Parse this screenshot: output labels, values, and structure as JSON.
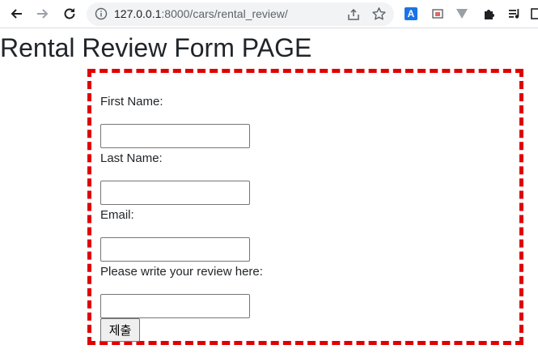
{
  "browser": {
    "url_host": "127.0.0.1",
    "url_path": ":8000/cars/rental_review/",
    "translate_label": "A"
  },
  "page": {
    "title": "Rental Review Form PAGE"
  },
  "form": {
    "fields": [
      {
        "label": "First Name:",
        "value": ""
      },
      {
        "label": "Last Name:",
        "value": ""
      },
      {
        "label": "Email:",
        "value": ""
      },
      {
        "label": "Please write your review here:",
        "value": ""
      }
    ],
    "submit_label": "제출"
  },
  "colors": {
    "form_border": "#e00000",
    "omnibox_bg": "#f1f3f4"
  }
}
